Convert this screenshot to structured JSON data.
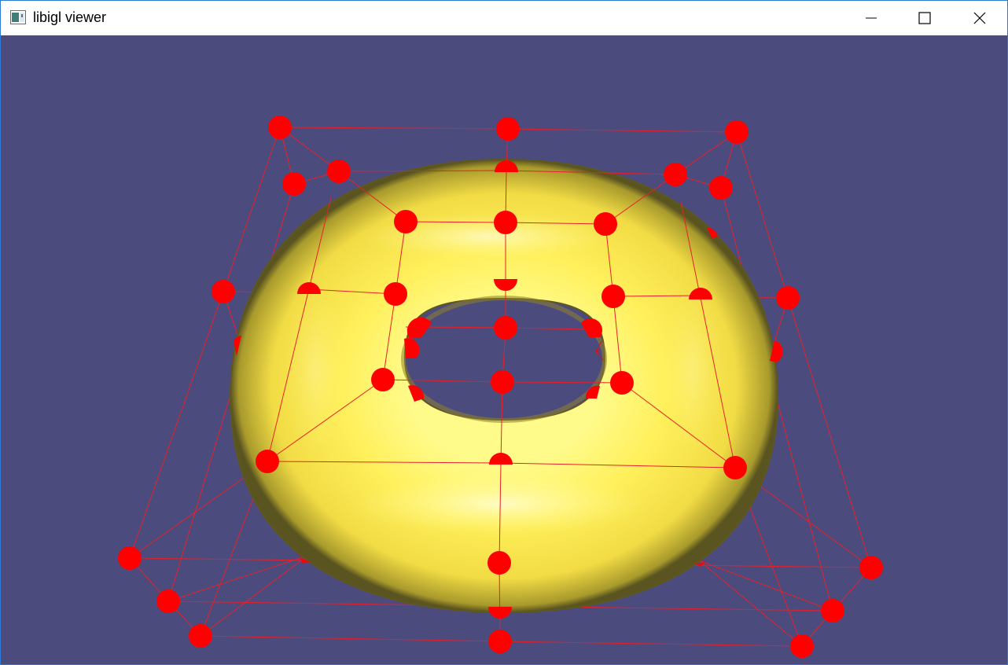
{
  "window": {
    "title": "libigl viewer",
    "icon": "app-window-icon",
    "controls": [
      "minimize-icon",
      "maximize-icon",
      "close-icon"
    ]
  },
  "viewport": {
    "background": "#4c4b7e",
    "mesh_color": "#ffef5a",
    "control_point_color": "#ff0000",
    "cage_line_color": "#e8202a"
  }
}
